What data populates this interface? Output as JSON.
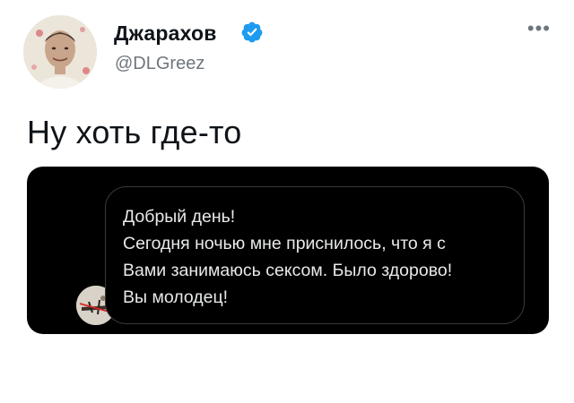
{
  "author": {
    "name": "Джарахов",
    "handle": "@DLGreez",
    "verified": true
  },
  "tweet": {
    "text": "Ну хоть где-то"
  },
  "media": {
    "message_lines": [
      "Добрый день!",
      "Сегодня ночью мне приснилось, что я с",
      "Вами занимаюсь сексом. Было здорово!",
      "Вы молодец!"
    ]
  },
  "icons": {
    "verified": "verified-badge-icon",
    "more": "more-options-icon"
  },
  "colors": {
    "verified_blue": "#1d9bf0",
    "handle_gray": "#6e767d",
    "card_black": "#000000",
    "bubble_border": "#3a3a3c"
  }
}
